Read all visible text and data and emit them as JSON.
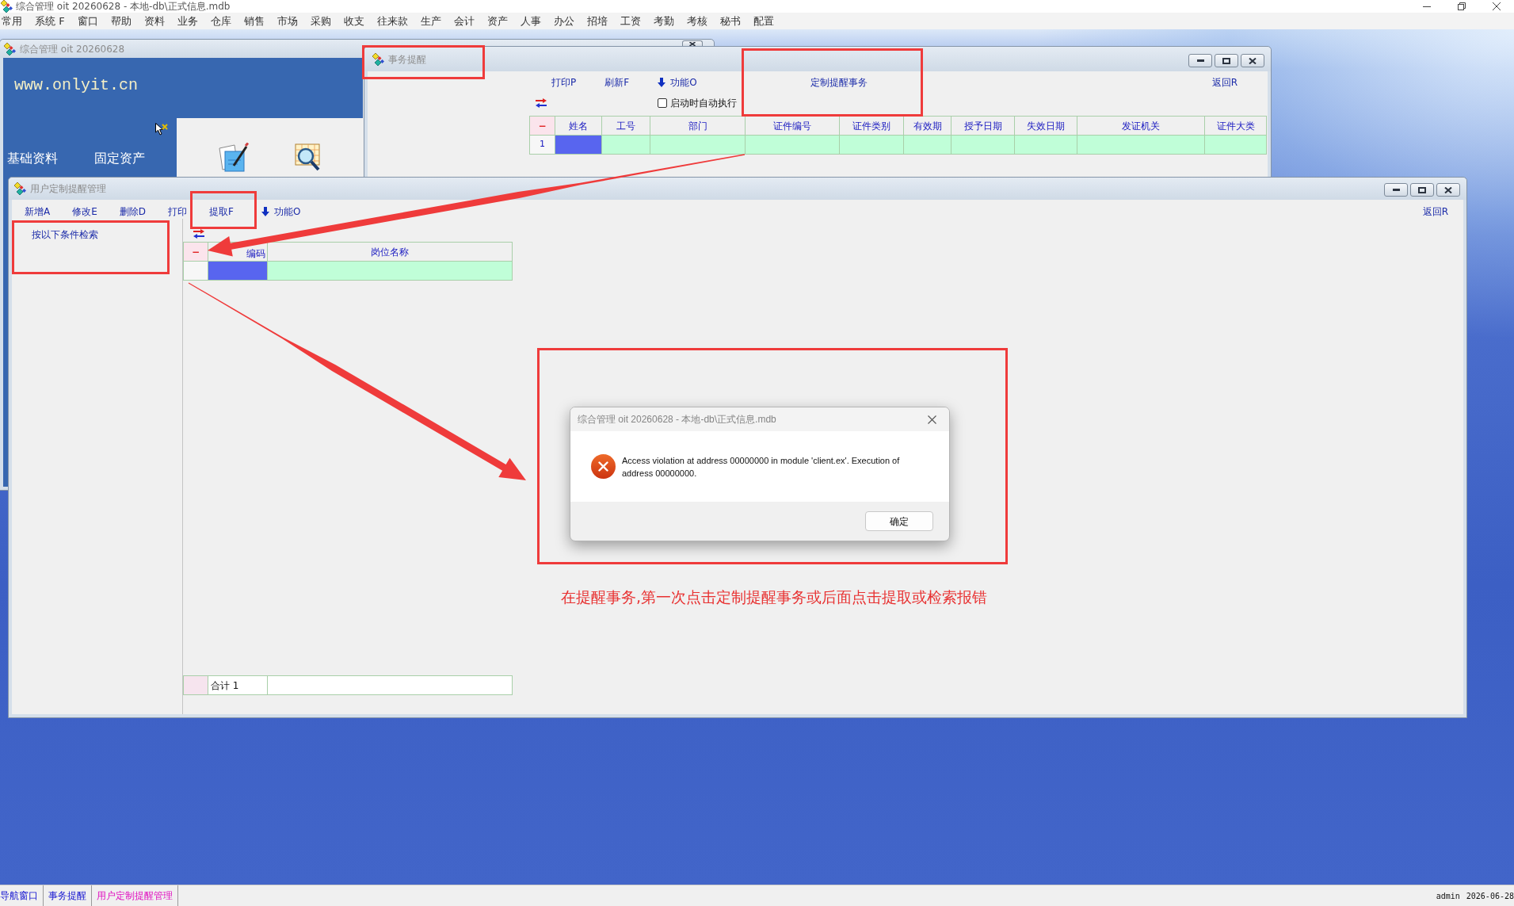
{
  "app": {
    "title": "综合管理 oit 20260628 - 本地-db\\正式信息.mdb"
  },
  "menu_bar": [
    "常用",
    "系统 F",
    "窗口",
    "帮助",
    "资料",
    "业务",
    "仓库",
    "销售",
    "市场",
    "采购",
    "收支",
    "往来款",
    "生产",
    "会计",
    "资产",
    "人事",
    "办公",
    "招培",
    "工资",
    "考勤",
    "考核",
    "秘书",
    "配置"
  ],
  "nav_window": {
    "title": "综合管理 oit 20260628",
    "website": "www.onlyit.cn",
    "modules": [
      "基础资料",
      "固定资产"
    ]
  },
  "reminder_window": {
    "title": "事务提醒",
    "toolbar": [
      {
        "label": "打印P",
        "kind": "command"
      },
      {
        "label": "刷新F",
        "kind": "command"
      },
      {
        "label": "功能O",
        "kind": "menu"
      }
    ],
    "customize_button": {
      "label": "定制提醒事务"
    },
    "back_button": {
      "label": "返回R"
    },
    "auto_run": {
      "label": "启动时自动执行",
      "checked": false
    },
    "table": {
      "corner_label": "−",
      "columns": [
        "姓名",
        "工号",
        "部门",
        "证件编号",
        "证件类别",
        "有效期",
        "授予日期",
        "失效日期",
        "发证机关",
        "证件大类"
      ],
      "rows": [
        {
          "number": "1",
          "cells": [
            {
              "selected": true
            },
            {
              "selected": false
            },
            {
              "selected": false
            },
            {
              "selected": false
            },
            {
              "selected": false
            },
            {
              "selected": false
            },
            {
              "selected": false
            },
            {
              "selected": false
            },
            {
              "selected": false
            },
            {
              "selected": false
            }
          ]
        }
      ]
    }
  },
  "custom_window": {
    "title": "用户定制提醒管理",
    "toolbar": [
      {
        "label": "新增A",
        "kind": "command"
      },
      {
        "label": "修改E",
        "kind": "command"
      },
      {
        "label": "删除D",
        "kind": "command"
      },
      {
        "label": "打印",
        "kind": "command"
      },
      {
        "label": "提取F",
        "kind": "command"
      },
      {
        "label": "功能O",
        "kind": "menu"
      }
    ],
    "back_button": {
      "label": "返回R"
    },
    "search_panel": {
      "title": "按以下条件检索"
    },
    "table": {
      "corner_label": "−",
      "columns": [
        "编码",
        "岗位名称"
      ],
      "rows": [
        {
          "cells": [
            {
              "selected": true
            },
            {
              "selected": false
            }
          ]
        }
      ],
      "footer": {
        "label": "合计 1"
      }
    }
  },
  "dialog": {
    "title": "综合管理 oit 20260628 - 本地-db\\正式信息.mdb",
    "kind": "error",
    "message": "Access violation at address 00000000 in module 'client.ex'. Execution of address 00000000.",
    "buttons": [
      "确定"
    ]
  },
  "annotation": {
    "caption": "在提醒事务,第一次点击定制提醒事务或后面点击提取或检索报错"
  },
  "status_bar": {
    "windows": [
      {
        "label": "导航窗口",
        "selected": false
      },
      {
        "label": "事务提醒",
        "selected": false
      },
      {
        "label": "用户定制提醒管理",
        "selected": true
      }
    ],
    "user": "admin",
    "date": "2026-06-28"
  }
}
